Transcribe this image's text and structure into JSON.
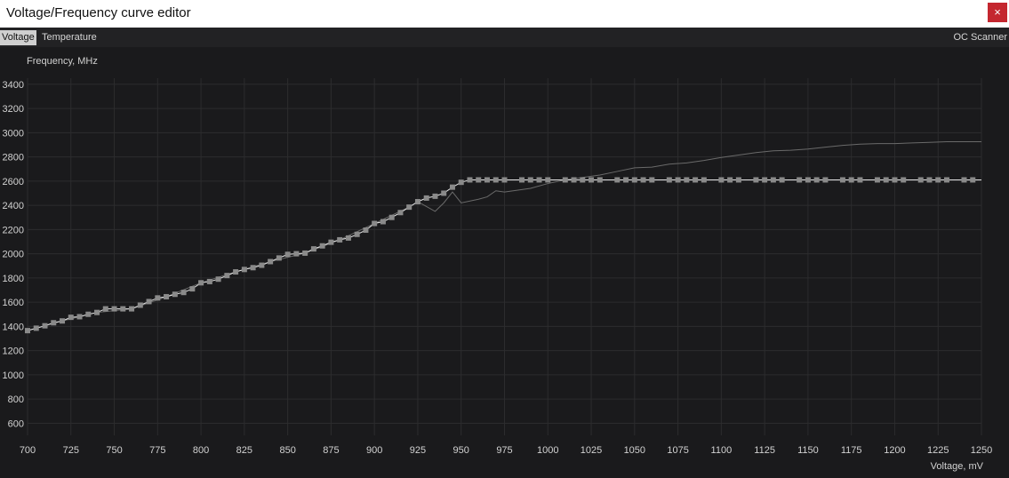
{
  "window": {
    "title": "Voltage/Frequency curve editor",
    "close_label": "×"
  },
  "tabs": [
    {
      "label": "Voltage",
      "active": true
    },
    {
      "label": "Temperature",
      "active": false
    }
  ],
  "oc_scanner_label": "OC Scanner",
  "colors": {
    "background": "#1a1a1c",
    "grid": "#2c2c2e",
    "curve": "#e6e6e6",
    "default_curve": "#6a6a6a",
    "point": "#8a8a8a",
    "close_button": "#c4272f"
  },
  "chart_data": {
    "type": "line",
    "ylabel": "Frequency, MHz",
    "xlabel": "Voltage, mV",
    "xlim": [
      700,
      1250
    ],
    "ylim": [
      500,
      3450
    ],
    "x_ticks": [
      700,
      725,
      750,
      775,
      800,
      825,
      850,
      875,
      900,
      925,
      950,
      975,
      1000,
      1025,
      1050,
      1075,
      1100,
      1125,
      1150,
      1175,
      1200,
      1225,
      1250
    ],
    "y_ticks": [
      600,
      800,
      1000,
      1200,
      1400,
      1600,
      1800,
      2000,
      2200,
      2400,
      2600,
      2800,
      3000,
      3200,
      3400
    ],
    "grid": true,
    "series": [
      {
        "x": [
          700,
          705,
          710,
          715,
          720,
          725,
          730,
          735,
          740,
          745,
          750,
          755,
          760,
          765,
          770,
          775,
          780,
          785,
          790,
          795,
          800,
          805,
          810,
          815,
          820,
          825,
          830,
          835,
          840,
          845,
          850,
          855,
          860,
          865,
          870,
          875,
          880,
          885,
          890,
          895,
          900,
          905,
          910,
          915,
          920,
          925,
          930,
          935,
          940,
          945,
          950,
          955,
          960,
          965,
          970,
          975,
          985,
          990,
          995,
          1000,
          1010,
          1015,
          1020,
          1025,
          1030,
          1040,
          1045,
          1050,
          1055,
          1060,
          1070,
          1075,
          1080,
          1085,
          1090,
          1100,
          1105,
          1110,
          1120,
          1125,
          1130,
          1135,
          1145,
          1150,
          1155,
          1160,
          1170,
          1175,
          1180,
          1190,
          1195,
          1200,
          1205,
          1215,
          1220,
          1225,
          1230,
          1240,
          1245
        ],
        "values": [
          1365,
          1385,
          1405,
          1430,
          1445,
          1475,
          1480,
          1500,
          1515,
          1545,
          1545,
          1545,
          1545,
          1575,
          1605,
          1635,
          1645,
          1665,
          1680,
          1710,
          1760,
          1770,
          1790,
          1820,
          1850,
          1870,
          1885,
          1905,
          1935,
          1965,
          1995,
          2000,
          2005,
          2040,
          2065,
          2095,
          2115,
          2130,
          2160,
          2195,
          2250,
          2265,
          2300,
          2340,
          2385,
          2430,
          2460,
          2475,
          2500,
          2550,
          2590,
          2610,
          2610,
          2610,
          2610,
          2610,
          2610,
          2610,
          2610,
          2610,
          2610,
          2610,
          2610,
          2610,
          2610,
          2610,
          2610,
          2610,
          2610,
          2610,
          2610,
          2610,
          2610,
          2610,
          2610,
          2610,
          2610,
          2610,
          2610,
          2610,
          2610,
          2610,
          2610,
          2610,
          2610,
          2610,
          2610,
          2610,
          2610,
          2610,
          2610,
          2610,
          2610,
          2610,
          2610,
          2610,
          2610,
          2610,
          2610
        ],
        "tail_x": 1250,
        "tail_value": 2610
      },
      {
        "x": [
          700,
          720,
          740,
          760,
          780,
          800,
          820,
          840,
          860,
          880,
          900,
          920,
          925,
          930,
          935,
          940,
          945,
          950,
          960,
          965,
          970,
          975,
          980,
          990,
          1000,
          1010,
          1020,
          1030,
          1040,
          1050,
          1060,
          1070,
          1080,
          1090,
          1100,
          1110,
          1120,
          1130,
          1140,
          1150,
          1160,
          1170,
          1180,
          1190,
          1200,
          1210,
          1220,
          1230,
          1240,
          1250
        ],
        "values": [
          1365,
          1445,
          1515,
          1545,
          1645,
          1760,
          1850,
          1935,
          2005,
          2115,
          2250,
          2385,
          2430,
          2390,
          2350,
          2420,
          2510,
          2420,
          2450,
          2470,
          2520,
          2510,
          2520,
          2540,
          2580,
          2610,
          2630,
          2650,
          2680,
          2710,
          2715,
          2740,
          2750,
          2770,
          2795,
          2815,
          2835,
          2850,
          2855,
          2865,
          2880,
          2895,
          2905,
          2910,
          2910,
          2915,
          2920,
          2925,
          2925,
          2925
        ]
      }
    ]
  }
}
